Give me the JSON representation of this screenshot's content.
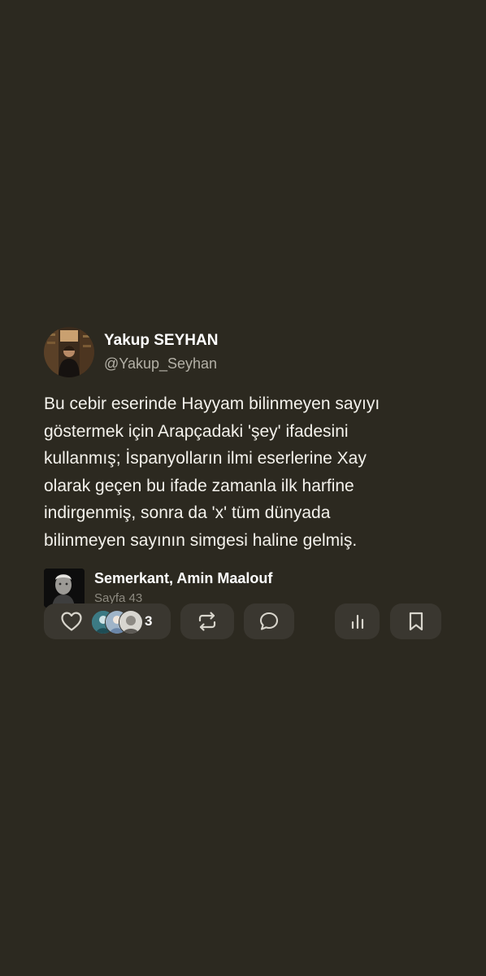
{
  "post": {
    "author": {
      "display_name": "Yakup SEYHAN",
      "handle": "@Yakup_Seyhan"
    },
    "text": "Bu cebir eserinde Hayyam bilinmeyen sayıyı\ngöstermek için Arapçadaki 'şey' ifadesini\nkullanmış; İspanyolların ilmi eserlerine Xay\nolarak geçen bu ifade zamanla ilk harfine\nindirgenmiş, sonra da 'x' tüm dünyada\nbilinmeyen sayının simgesi haline gelmiş.",
    "book": {
      "title": "Semerkant, Amin Maalouf",
      "page": "Sayfa 43"
    }
  },
  "actions": {
    "like_count": "3",
    "icons": {
      "like": "heart-icon",
      "repost": "repost-icon",
      "comment": "comment-icon",
      "stats": "stats-icon",
      "save": "bookmark-icon"
    }
  },
  "colors": {
    "background": "#2c2920",
    "pill": "#3a3730",
    "muted_text": "#b3b0a6",
    "icon": "#d8d5cc"
  }
}
